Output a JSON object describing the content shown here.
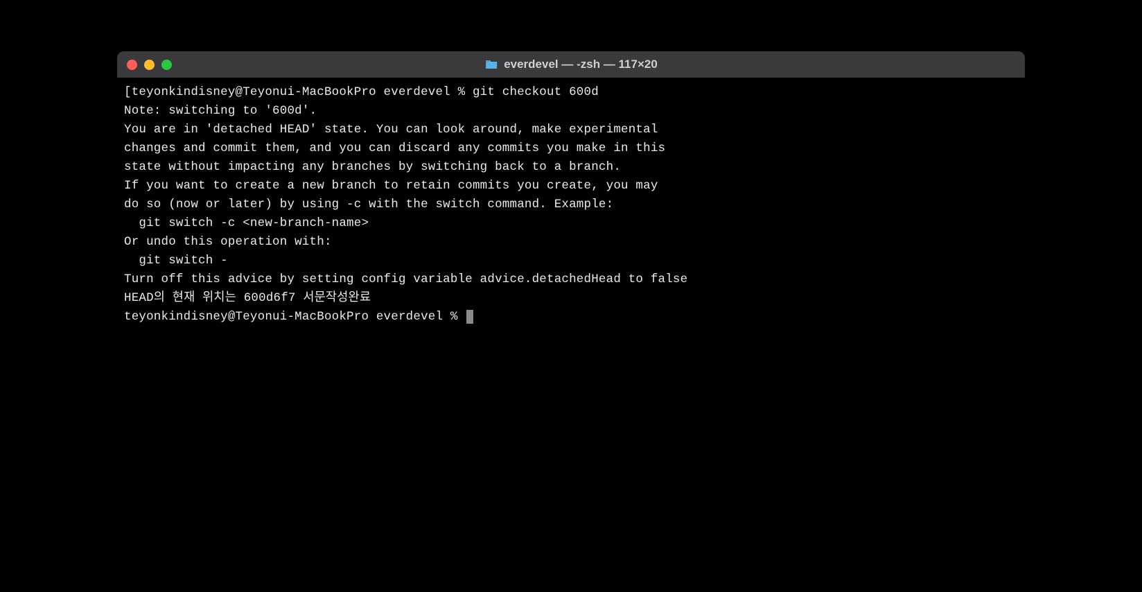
{
  "window": {
    "title": "everdevel — -zsh — 117×20"
  },
  "terminal": {
    "lines": [
      "[teyonkindisney@Teyonui-MacBookPro everdevel % git checkout 600d",
      "Note: switching to '600d'.",
      "",
      "You are in 'detached HEAD' state. You can look around, make experimental",
      "changes and commit them, and you can discard any commits you make in this",
      "state without impacting any branches by switching back to a branch.",
      "",
      "If you want to create a new branch to retain commits you create, you may",
      "do so (now or later) by using -c with the switch command. Example:",
      "",
      "  git switch -c <new-branch-name>",
      "",
      "Or undo this operation with:",
      "",
      "  git switch -",
      "",
      "Turn off this advice by setting config variable advice.detachedHead to false",
      "",
      "HEAD의 현재 위치는 600d6f7 서문작성완료",
      "teyonkindisney@Teyonui-MacBookPro everdevel % "
    ]
  }
}
